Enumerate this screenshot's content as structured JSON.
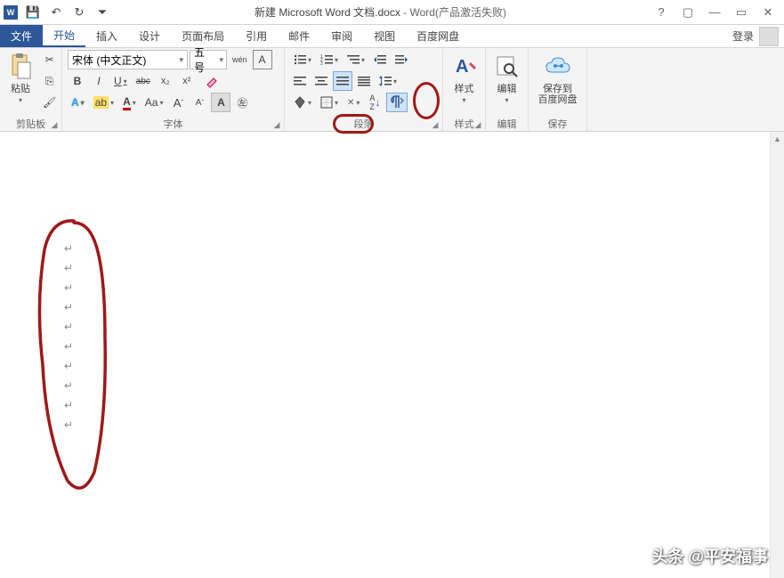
{
  "titlebar": {
    "doc_name": "新建 Microsoft Word 文档.docx",
    "app_suffix": " - Word(产品激活失败)",
    "qat": {
      "save": "💾",
      "undo": "↶",
      "redo": "↻",
      "custom": "⏷"
    }
  },
  "tabs": {
    "file": "文件",
    "home": "开始",
    "insert": "插入",
    "design": "设计",
    "layout": "页面布局",
    "references": "引用",
    "mailings": "邮件",
    "review": "审阅",
    "view": "视图",
    "baidu": "百度网盘",
    "login": "登录"
  },
  "ribbon": {
    "clipboard": {
      "label": "剪贴板",
      "paste": "粘贴",
      "cut": "✂",
      "copy": "⎘",
      "painter": "🖌"
    },
    "font": {
      "label": "字体",
      "name": "宋体 (中文正文)",
      "size": "五号",
      "wen": "wén",
      "A_box": "A",
      "bold": "B",
      "italic": "I",
      "underline": "U",
      "strike": "abc",
      "sub": "x₂",
      "sup": "x²",
      "clear": "◇",
      "effects": "A",
      "highlight": "ab⁄",
      "color": "A",
      "phonetic": "Aa",
      "grow": "A▴",
      "shrink": "A▾",
      "charshade": "A",
      "border": "⿴",
      "case": "⓵"
    },
    "paragraph": {
      "label": "段落",
      "bullets": "•≡",
      "numbering": "1≡",
      "multilevel": "⋮≡",
      "dec_indent": "⇤",
      "inc_indent": "⇥",
      "marks": "¶",
      "left": "≡",
      "center": "≡",
      "right": "≡",
      "justify": "≡",
      "dist": "≣",
      "linespace": "↕≡",
      "shading": "◆",
      "borders": "▭",
      "sort": "A↓Z",
      "showhide": "¶"
    },
    "styles": {
      "label": "样式",
      "btn": "样式",
      "icon": "A"
    },
    "editing": {
      "label": "编辑",
      "btn": "编辑",
      "icon": "🔍"
    },
    "save_section": {
      "label": "保存",
      "btn": "保存到\n百度网盘"
    }
  },
  "document": {
    "paragraph_marks_count": 10,
    "mark": "↵"
  },
  "watermark": "头条 @平安福事"
}
